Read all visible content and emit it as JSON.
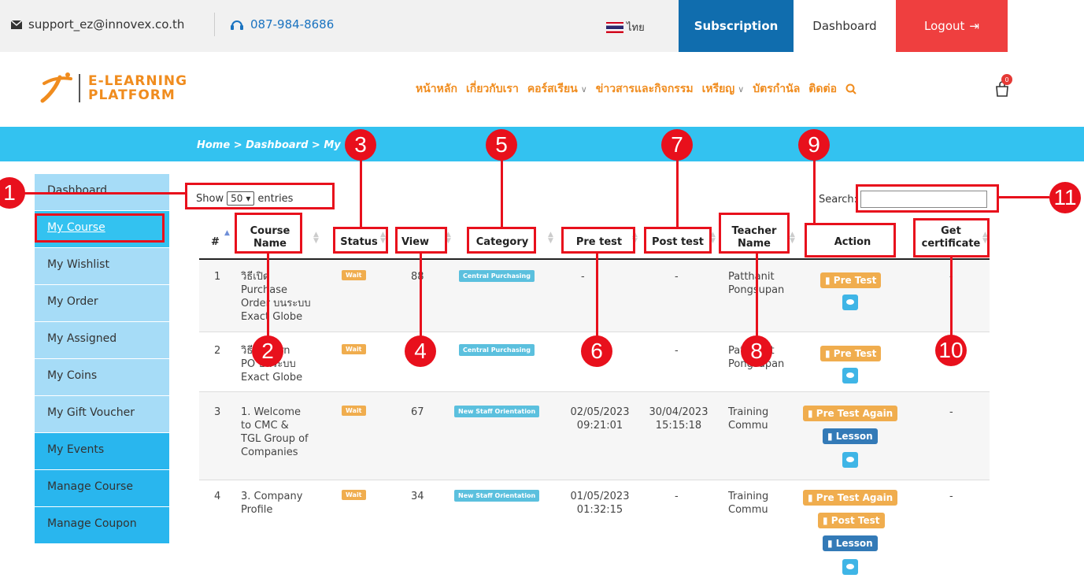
{
  "topbar": {
    "email": "support_ez@innovex.co.th",
    "phone": "087-984-8686",
    "language": "ไทย",
    "subscription": "Subscription",
    "dashboard": "Dashboard",
    "logout": "Logout"
  },
  "logo": {
    "line1": "E-LEARNING",
    "line2": "PLATFORM"
  },
  "nav": [
    "หน้าหลัก",
    "เกี่ยวกับเรา",
    "คอร์สเรียน",
    "ข่าวสารและกิจกรรม",
    "เหรียญ",
    "บัตรกำนัล",
    "ติดต่อ"
  ],
  "cart_count": "0",
  "breadcrumb": "Home > Dashboard > My",
  "sidebar": [
    "Dashboard",
    "My Course",
    "My Wishlist",
    "My Order",
    "My Assigned",
    "My Coins",
    "My Gift Voucher",
    "My Events",
    "Manage Course",
    "Manage Coupon"
  ],
  "controls": {
    "show": "Show",
    "entries_value": "50",
    "entries": "entries",
    "search": "Search:"
  },
  "headers": {
    "num": "#",
    "course1": "Course",
    "course2": "Name",
    "status": "Status",
    "view": "View",
    "category": "Category",
    "pre": "Pre test",
    "post": "Post test",
    "teacher1": "Teacher",
    "teacher2": "Name",
    "action": "Action",
    "cert1": "Get",
    "cert2": "certificate"
  },
  "rows": [
    {
      "num": "1",
      "course": [
        "วิธีเปิด",
        "Purchase",
        "Order บนระบบ",
        "Exact Globe"
      ],
      "status": "Wait",
      "view": "88",
      "category": "Central Purchasing",
      "pre": [
        "-"
      ],
      "post": [
        "-"
      ],
      "teacher": [
        "Patthanit",
        "Pongsupan"
      ],
      "actions": [
        "Pre Test"
      ],
      "cert": "-"
    },
    {
      "num": "2",
      "course": [
        "วิธี Return",
        "PO บนระบบ",
        "Exact Globe"
      ],
      "status": "Wait",
      "view": "",
      "category": "Central Purchasing",
      "pre": [
        ""
      ],
      "post": [
        "-"
      ],
      "teacher": [
        "Patthanit",
        "Pongsupan"
      ],
      "actions": [
        "Pre Test"
      ],
      "cert": ""
    },
    {
      "num": "3",
      "course": [
        "1. Welcome",
        "to CMC &",
        "TGL Group of",
        "Companies"
      ],
      "status": "Wait",
      "view": "67",
      "category": "New Staff Orientation",
      "pre": [
        "02/05/2023",
        "09:21:01"
      ],
      "post": [
        "30/04/2023",
        "15:15:18"
      ],
      "teacher": [
        "Training",
        "Commu"
      ],
      "actions": [
        "Pre Test Again",
        "Lesson"
      ],
      "cert": "-"
    },
    {
      "num": "4",
      "course": [
        "3. Company",
        "Profile"
      ],
      "status": "Wait",
      "view": "34",
      "category": "New Staff Orientation",
      "pre": [
        "01/05/2023",
        "01:32:15"
      ],
      "post": [
        "-"
      ],
      "teacher": [
        "Training",
        "Commu"
      ],
      "actions": [
        "Pre Test Again",
        "Post Test",
        "Lesson"
      ],
      "cert": "-"
    }
  ],
  "annotations": [
    "1",
    "2",
    "3",
    "4",
    "5",
    "6",
    "7",
    "8",
    "9",
    "10",
    "11"
  ],
  "colors": {
    "accent": "#33c2f0",
    "brand": "#f08c1e",
    "annotation": "#e8101c",
    "subscription": "#106dae",
    "logout": "#ef3f3f"
  }
}
